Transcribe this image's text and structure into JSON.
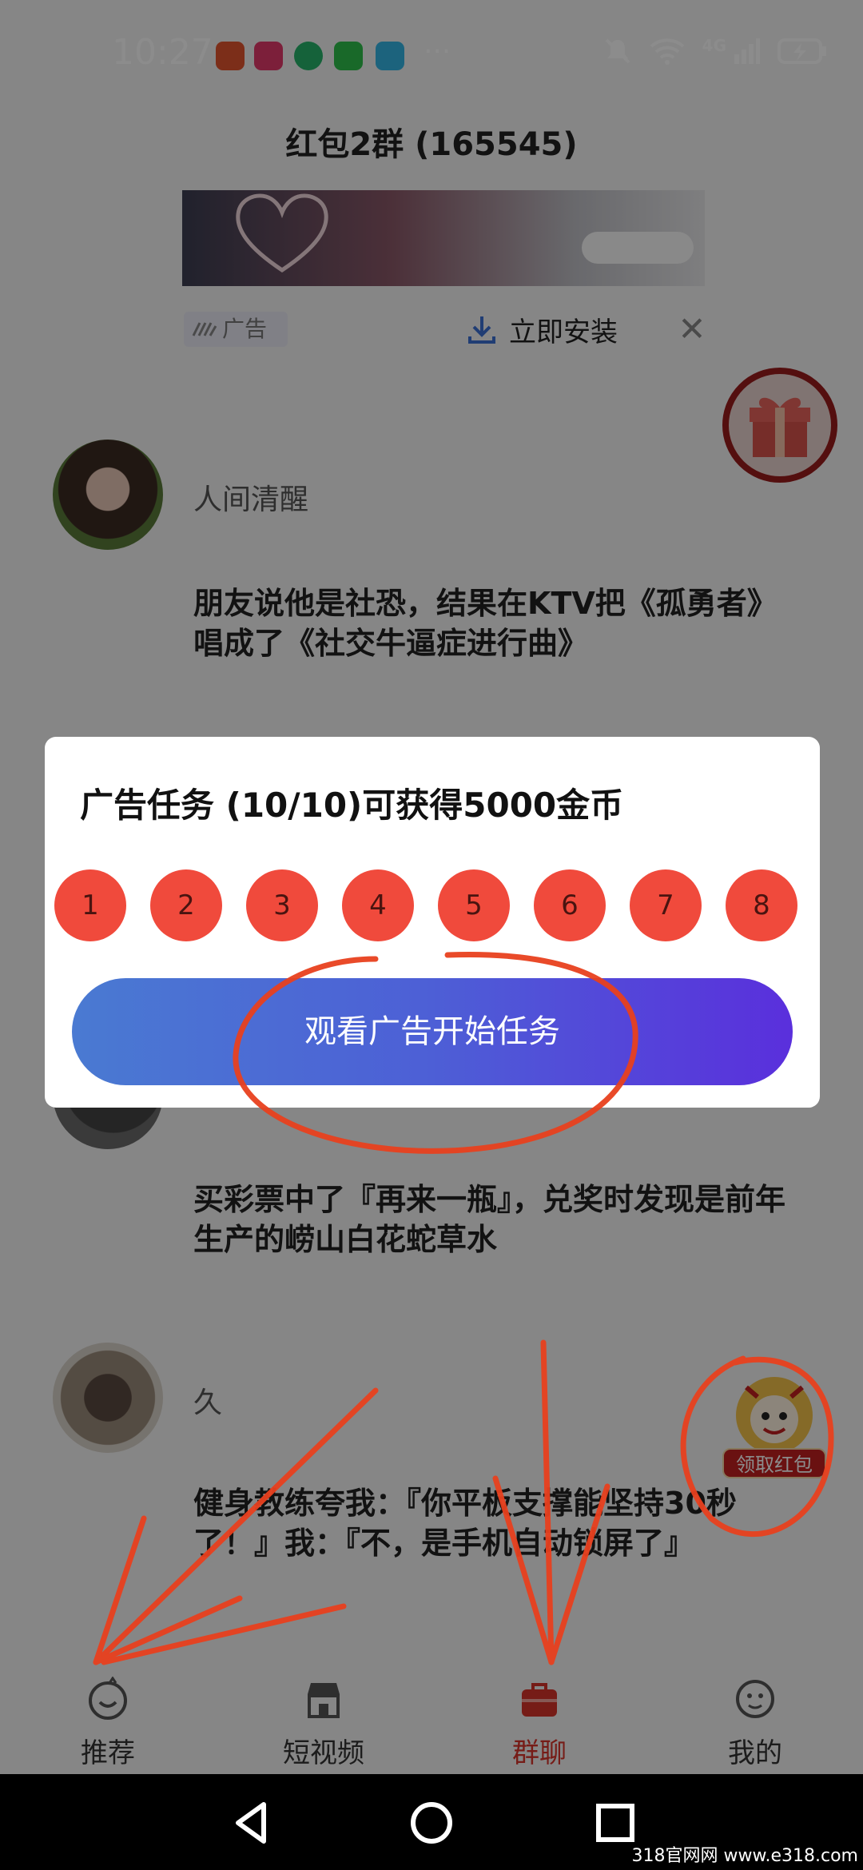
{
  "status_bar": {
    "time": "10:27",
    "overflow": "···",
    "network": "4G"
  },
  "header": {
    "title": "红包2群 (165545)"
  },
  "ad": {
    "tag": "广告",
    "install_label": "立即安装",
    "close_glyph": "✕"
  },
  "messages": [
    {
      "name": "人间清醒",
      "text": "朋友说他是社恐，结果在KTV把《孤勇者》唱成了《社交牛逼症进行曲》"
    },
    {
      "name": "",
      "text": "买彩票中了『再来一瓶』，兑奖时发现是前年生产的崂山白花蛇草水"
    },
    {
      "name": "久",
      "text": "健身教练夸我：『你平板支撑能坚持30秒了！』我：『不，是手机自动锁屏了』"
    }
  ],
  "dialog": {
    "title": "广告任务 (10/10)可获得5000金币",
    "steps": [
      "1",
      "2",
      "3",
      "4",
      "5",
      "6",
      "7",
      "8"
    ],
    "action_label": "观看广告开始任务"
  },
  "float_redpacket": {
    "label": "领取红包"
  },
  "bottom_nav": {
    "items": [
      {
        "label": "推荐",
        "icon": "recommend-icon"
      },
      {
        "label": "短视频",
        "icon": "shop-icon"
      },
      {
        "label": "群聊",
        "icon": "briefcase-icon",
        "active": true
      },
      {
        "label": "我的",
        "icon": "face-icon"
      }
    ]
  },
  "watermark": "318官网网 www.e318.com",
  "colors": {
    "accent_red": "#d8332a",
    "step_red": "#f04a3c",
    "button_gradient_start": "#4a7ad2",
    "button_gradient_end": "#5a2fdc",
    "annotation_red": "#e8401e"
  }
}
